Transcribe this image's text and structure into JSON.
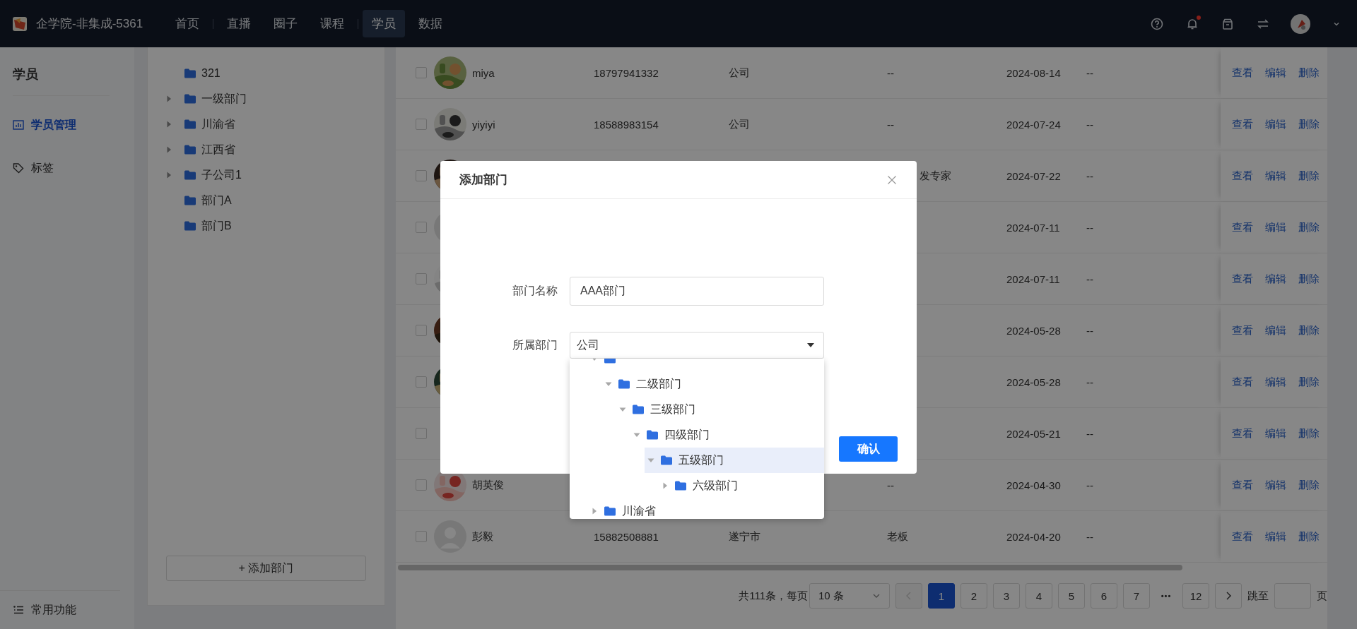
{
  "app": {
    "title": "企学院-非集成-5361"
  },
  "nav": [
    {
      "label": "首页",
      "selected": false
    },
    {
      "label": "直播",
      "selected": false
    },
    {
      "label": "圈子",
      "selected": false
    },
    {
      "label": "课程",
      "selected": false
    },
    {
      "label": "学员",
      "selected": true
    },
    {
      "label": "数据",
      "selected": false
    }
  ],
  "notifications": {
    "unread": true
  },
  "sidebar": {
    "title": "学员",
    "items": [
      {
        "label": "学员管理",
        "selected": true
      },
      {
        "label": "标签",
        "selected": false
      }
    ],
    "footer": "常用功能"
  },
  "department_tree": {
    "items": [
      {
        "label": "321",
        "kind": "leaf"
      },
      {
        "label": "一级部门",
        "kind": "branch"
      },
      {
        "label": "川渝省",
        "kind": "branch"
      },
      {
        "label": "江西省",
        "kind": "branch"
      },
      {
        "label": "子公司1",
        "kind": "branch"
      },
      {
        "label": "部门A",
        "kind": "leaf"
      },
      {
        "label": "部门B",
        "kind": "leaf"
      }
    ],
    "add_button": "+ 添加部门"
  },
  "table": {
    "rows": [
      {
        "checked": false,
        "name": "miya",
        "phone": "18797941332",
        "department": "公司",
        "position": "--",
        "joined": "2024-08-14",
        "column_7": "--",
        "actions": [
          "查看",
          "编辑",
          "删除"
        ]
      },
      {
        "checked": false,
        "name": "yiyiyi",
        "phone": "18588983154",
        "department": "公司",
        "position": "--",
        "joined": "2024-07-24",
        "column_7": "--",
        "actions": [
          "查看",
          "编辑",
          "删除"
        ]
      },
      {
        "checked": false,
        "position": "发专家",
        "position_covered": true,
        "joined": "2024-07-22",
        "column_7": "--",
        "actions": [
          "查看",
          "编辑",
          "删除"
        ]
      },
      {
        "checked": false,
        "avatar": {
          "kind": "default"
        },
        "joined": "2024-07-11",
        "column_7": "--",
        "actions": [
          "查看",
          "编辑",
          "删除"
        ]
      },
      {
        "checked": false,
        "joined": "2024-07-11",
        "column_7": "--",
        "actions": [
          "查看",
          "编辑",
          "删除"
        ]
      },
      {
        "checked": false,
        "joined": "2024-05-28",
        "column_7": "--",
        "actions": [
          "查看",
          "编辑",
          "删除"
        ]
      },
      {
        "checked": false,
        "joined": "2024-05-28",
        "column_7": "--",
        "actions": [
          "查看",
          "编辑",
          "删除"
        ]
      },
      {
        "checked": false,
        "joined": "2024-05-21",
        "column_7": "--",
        "actions": [
          "查看",
          "编辑",
          "删除"
        ]
      },
      {
        "checked": false,
        "name": "胡英俊",
        "position": "--",
        "joined": "2024-04-30",
        "column_7": "--",
        "actions": [
          "查看",
          "编辑",
          "删除"
        ]
      },
      {
        "checked": false,
        "avatar": {
          "kind": "default"
        },
        "name": "彭毅",
        "phone": "15882508881",
        "department": "遂宁市",
        "position": "老板",
        "joined": "2024-04-20",
        "column_7": "--",
        "actions": [
          "查看",
          "编辑",
          "删除"
        ]
      }
    ]
  },
  "pagination": {
    "total": "共111条，每页",
    "page_size": "10 条",
    "prev_disabled": true,
    "pages": [
      {
        "label": "1",
        "kind": "page",
        "selected": true
      },
      {
        "label": "2",
        "kind": "page",
        "selected": false
      },
      {
        "label": "3",
        "kind": "page",
        "selected": false
      },
      {
        "label": "4",
        "kind": "page",
        "selected": false
      },
      {
        "label": "5",
        "kind": "page",
        "selected": false
      },
      {
        "label": "6",
        "kind": "page",
        "selected": false
      },
      {
        "label": "7",
        "kind": "page",
        "selected": false
      },
      {
        "label": "•••",
        "kind": "ellipsis"
      },
      {
        "label": "12",
        "kind": "page",
        "selected": false
      }
    ],
    "jump_label": "跳至",
    "page_unit": "页"
  },
  "dialog": {
    "title": "添加部门",
    "fields": [
      {
        "label": "部门名称",
        "kind": "input",
        "value": "AAA部门"
      },
      {
        "label": "所属部门",
        "kind": "select",
        "value": "公司",
        "expanded": true
      }
    ],
    "dropdown": {
      "items": [
        {
          "expanded": true,
          "selected": false,
          "children": [
            {
              "label": "二级部门",
              "expanded": true,
              "selected": false,
              "children": [
                {
                  "label": "三级部门",
                  "expanded": true,
                  "selected": false,
                  "children": [
                    {
                      "label": "四级部门",
                      "expanded": true,
                      "selected": false,
                      "children": [
                        {
                          "label": "五级部门",
                          "expanded": true,
                          "selected": true,
                          "children": [
                            {
                              "label": "六级部门",
                              "expanded": false,
                              "selected": false
                            }
                          ]
                        }
                      ]
                    }
                  ]
                }
              ]
            }
          ]
        },
        {
          "label": "川渝省",
          "expanded": false,
          "selected": false
        }
      ]
    },
    "confirm": "确认"
  }
}
